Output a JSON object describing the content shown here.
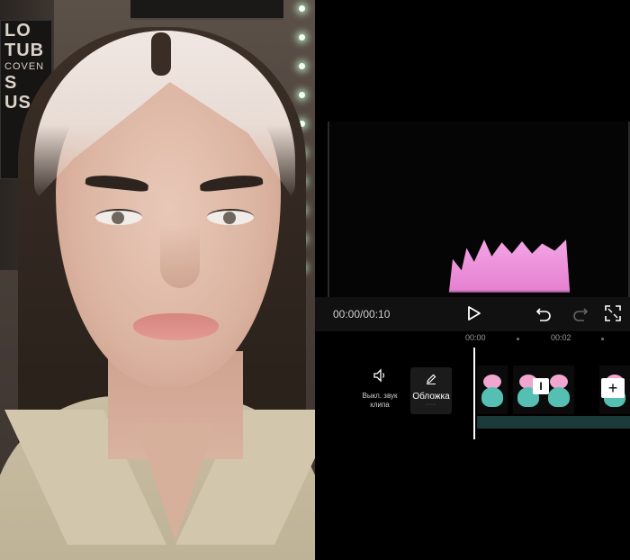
{
  "webcam": {
    "poster_lines": [
      "LO",
      "TUB",
      "COVEN",
      "S",
      "US"
    ]
  },
  "editor": {
    "time_display": "00:00/00:10",
    "ruler": [
      "00:00",
      "00:02"
    ],
    "tools": {
      "mute_label": "Выкл. звук клипа",
      "cover_label": "Обложка"
    },
    "icons": {
      "play": "play-icon",
      "undo": "undo-icon",
      "redo": "redo-icon",
      "fullscreen": "fullscreen-icon",
      "speaker": "speaker-icon",
      "pencil": "pencil-icon"
    },
    "colors": {
      "background": "#000000",
      "transport": "#111111",
      "clip_pink": "#f0a6cf",
      "clip_teal": "#56bfb3"
    }
  }
}
